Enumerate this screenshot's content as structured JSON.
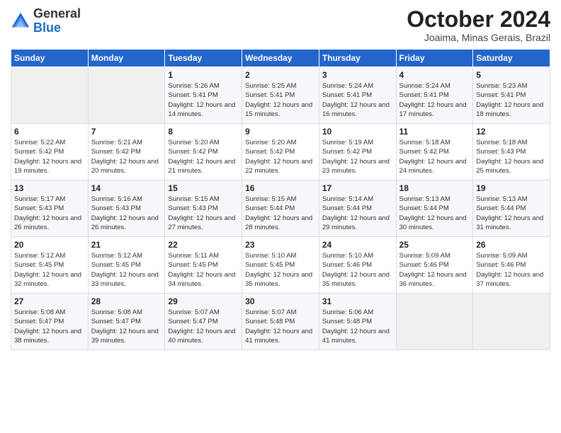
{
  "header": {
    "logo_general": "General",
    "logo_blue": "Blue",
    "month_title": "October 2024",
    "location": "Joaima, Minas Gerais, Brazil"
  },
  "days_of_week": [
    "Sunday",
    "Monday",
    "Tuesday",
    "Wednesday",
    "Thursday",
    "Friday",
    "Saturday"
  ],
  "weeks": [
    [
      {
        "day": "",
        "sunrise": "",
        "sunset": "",
        "daylight": ""
      },
      {
        "day": "",
        "sunrise": "",
        "sunset": "",
        "daylight": ""
      },
      {
        "day": "1",
        "sunrise": "Sunrise: 5:26 AM",
        "sunset": "Sunset: 5:41 PM",
        "daylight": "Daylight: 12 hours and 14 minutes."
      },
      {
        "day": "2",
        "sunrise": "Sunrise: 5:25 AM",
        "sunset": "Sunset: 5:41 PM",
        "daylight": "Daylight: 12 hours and 15 minutes."
      },
      {
        "day": "3",
        "sunrise": "Sunrise: 5:24 AM",
        "sunset": "Sunset: 5:41 PM",
        "daylight": "Daylight: 12 hours and 16 minutes."
      },
      {
        "day": "4",
        "sunrise": "Sunrise: 5:24 AM",
        "sunset": "Sunset: 5:41 PM",
        "daylight": "Daylight: 12 hours and 17 minutes."
      },
      {
        "day": "5",
        "sunrise": "Sunrise: 5:23 AM",
        "sunset": "Sunset: 5:41 PM",
        "daylight": "Daylight: 12 hours and 18 minutes."
      }
    ],
    [
      {
        "day": "6",
        "sunrise": "Sunrise: 5:22 AM",
        "sunset": "Sunset: 5:42 PM",
        "daylight": "Daylight: 12 hours and 19 minutes."
      },
      {
        "day": "7",
        "sunrise": "Sunrise: 5:21 AM",
        "sunset": "Sunset: 5:42 PM",
        "daylight": "Daylight: 12 hours and 20 minutes."
      },
      {
        "day": "8",
        "sunrise": "Sunrise: 5:20 AM",
        "sunset": "Sunset: 5:42 PM",
        "daylight": "Daylight: 12 hours and 21 minutes."
      },
      {
        "day": "9",
        "sunrise": "Sunrise: 5:20 AM",
        "sunset": "Sunset: 5:42 PM",
        "daylight": "Daylight: 12 hours and 22 minutes."
      },
      {
        "day": "10",
        "sunrise": "Sunrise: 5:19 AM",
        "sunset": "Sunset: 5:42 PM",
        "daylight": "Daylight: 12 hours and 23 minutes."
      },
      {
        "day": "11",
        "sunrise": "Sunrise: 5:18 AM",
        "sunset": "Sunset: 5:42 PM",
        "daylight": "Daylight: 12 hours and 24 minutes."
      },
      {
        "day": "12",
        "sunrise": "Sunrise: 5:18 AM",
        "sunset": "Sunset: 5:43 PM",
        "daylight": "Daylight: 12 hours and 25 minutes."
      }
    ],
    [
      {
        "day": "13",
        "sunrise": "Sunrise: 5:17 AM",
        "sunset": "Sunset: 5:43 PM",
        "daylight": "Daylight: 12 hours and 26 minutes."
      },
      {
        "day": "14",
        "sunrise": "Sunrise: 5:16 AM",
        "sunset": "Sunset: 5:43 PM",
        "daylight": "Daylight: 12 hours and 26 minutes."
      },
      {
        "day": "15",
        "sunrise": "Sunrise: 5:15 AM",
        "sunset": "Sunset: 5:43 PM",
        "daylight": "Daylight: 12 hours and 27 minutes."
      },
      {
        "day": "16",
        "sunrise": "Sunrise: 5:15 AM",
        "sunset": "Sunset: 5:44 PM",
        "daylight": "Daylight: 12 hours and 28 minutes."
      },
      {
        "day": "17",
        "sunrise": "Sunrise: 5:14 AM",
        "sunset": "Sunset: 5:44 PM",
        "daylight": "Daylight: 12 hours and 29 minutes."
      },
      {
        "day": "18",
        "sunrise": "Sunrise: 5:13 AM",
        "sunset": "Sunset: 5:44 PM",
        "daylight": "Daylight: 12 hours and 30 minutes."
      },
      {
        "day": "19",
        "sunrise": "Sunrise: 5:13 AM",
        "sunset": "Sunset: 5:44 PM",
        "daylight": "Daylight: 12 hours and 31 minutes."
      }
    ],
    [
      {
        "day": "20",
        "sunrise": "Sunrise: 5:12 AM",
        "sunset": "Sunset: 5:45 PM",
        "daylight": "Daylight: 12 hours and 32 minutes."
      },
      {
        "day": "21",
        "sunrise": "Sunrise: 5:12 AM",
        "sunset": "Sunset: 5:45 PM",
        "daylight": "Daylight: 12 hours and 33 minutes."
      },
      {
        "day": "22",
        "sunrise": "Sunrise: 5:11 AM",
        "sunset": "Sunset: 5:45 PM",
        "daylight": "Daylight: 12 hours and 34 minutes."
      },
      {
        "day": "23",
        "sunrise": "Sunrise: 5:10 AM",
        "sunset": "Sunset: 5:45 PM",
        "daylight": "Daylight: 12 hours and 35 minutes."
      },
      {
        "day": "24",
        "sunrise": "Sunrise: 5:10 AM",
        "sunset": "Sunset: 5:46 PM",
        "daylight": "Daylight: 12 hours and 35 minutes."
      },
      {
        "day": "25",
        "sunrise": "Sunrise: 5:09 AM",
        "sunset": "Sunset: 5:46 PM",
        "daylight": "Daylight: 12 hours and 36 minutes."
      },
      {
        "day": "26",
        "sunrise": "Sunrise: 5:09 AM",
        "sunset": "Sunset: 5:46 PM",
        "daylight": "Daylight: 12 hours and 37 minutes."
      }
    ],
    [
      {
        "day": "27",
        "sunrise": "Sunrise: 5:08 AM",
        "sunset": "Sunset: 5:47 PM",
        "daylight": "Daylight: 12 hours and 38 minutes."
      },
      {
        "day": "28",
        "sunrise": "Sunrise: 5:08 AM",
        "sunset": "Sunset: 5:47 PM",
        "daylight": "Daylight: 12 hours and 39 minutes."
      },
      {
        "day": "29",
        "sunrise": "Sunrise: 5:07 AM",
        "sunset": "Sunset: 5:47 PM",
        "daylight": "Daylight: 12 hours and 40 minutes."
      },
      {
        "day": "30",
        "sunrise": "Sunrise: 5:07 AM",
        "sunset": "Sunset: 5:48 PM",
        "daylight": "Daylight: 12 hours and 41 minutes."
      },
      {
        "day": "31",
        "sunrise": "Sunrise: 5:06 AM",
        "sunset": "Sunset: 5:48 PM",
        "daylight": "Daylight: 12 hours and 41 minutes."
      },
      {
        "day": "",
        "sunrise": "",
        "sunset": "",
        "daylight": ""
      },
      {
        "day": "",
        "sunrise": "",
        "sunset": "",
        "daylight": ""
      }
    ]
  ]
}
